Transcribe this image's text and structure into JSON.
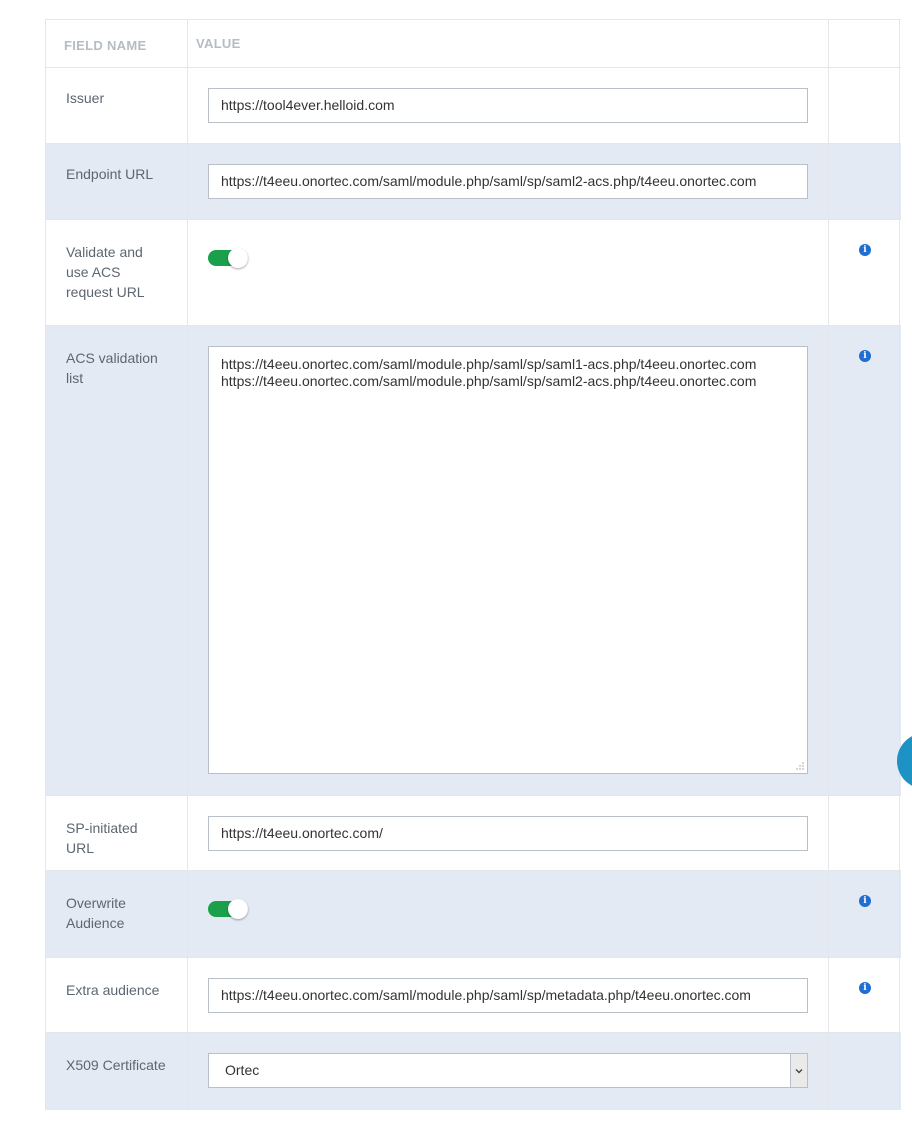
{
  "header": {
    "field_name": "FIELD NAME",
    "value": "VALUE"
  },
  "rows": {
    "issuer": {
      "label": "Issuer",
      "value": "https://tool4ever.helloid.com"
    },
    "endpoint": {
      "label": "Endpoint URL",
      "value": "https://t4eeu.onortec.com/saml/module.php/saml/sp/saml2-acs.php/t4eeu.onortec.com"
    },
    "validate": {
      "label": "Validate and use ACS request URL",
      "enabled": true
    },
    "acs_list": {
      "label": "ACS validation list",
      "lines": [
        "https://t4eeu.onortec.com/saml/module.php/saml/sp/saml1-acs.php/t4eeu.onortec.com",
        "https://t4eeu.onortec.com/saml/module.php/saml/sp/saml2-acs.php/t4eeu.onortec.com"
      ]
    },
    "sp_initiated": {
      "label": "SP-initiated URL",
      "value": "https://t4eeu.onortec.com/"
    },
    "overwrite": {
      "label": "Overwrite Audience",
      "enabled": true
    },
    "extra_audience": {
      "label": "Extra audience",
      "value": "https://t4eeu.onortec.com/saml/module.php/saml/sp/metadata.php/t4eeu.onortec.com"
    },
    "x509": {
      "label": "X509 Certificate",
      "selected": "Ortec"
    }
  },
  "icons": {
    "info": "info-circle-icon",
    "dropdown": "chevron-down-icon"
  },
  "colors": {
    "toggle_on": "#1aa04a",
    "info": "#1f6ed0",
    "row_alt": "#e3eaf3",
    "floating_button": "#1d92c4"
  }
}
